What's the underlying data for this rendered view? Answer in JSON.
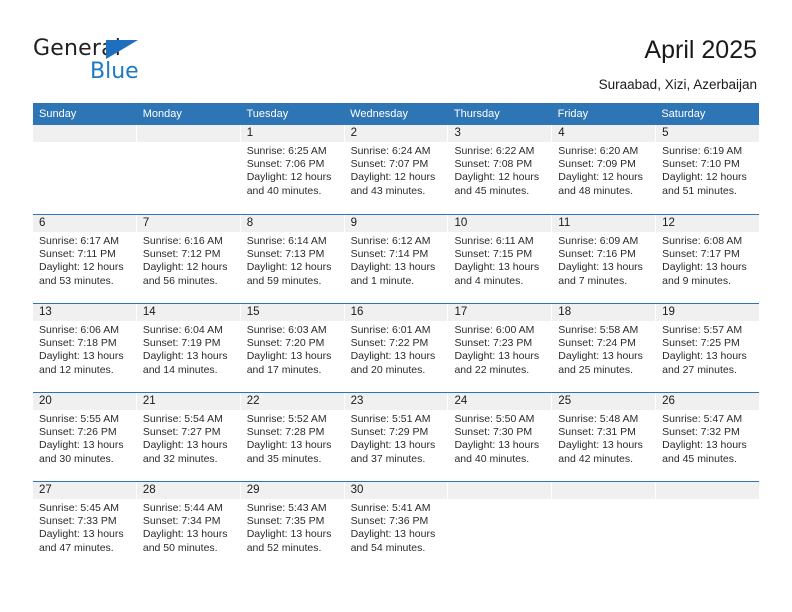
{
  "brand": {
    "name_top": "General",
    "name_bottom": "Blue",
    "accent_color": "#1f7ac4",
    "triangle_color": "#1f6fc0"
  },
  "header": {
    "title": "April 2025",
    "subtitle": "Suraabad, Xizi, Azerbaijan",
    "header_bg": "#2e75b6",
    "daynum_band_bg": "#f0f0f0"
  },
  "weekdays": [
    "Sunday",
    "Monday",
    "Tuesday",
    "Wednesday",
    "Thursday",
    "Friday",
    "Saturday"
  ],
  "weeks": [
    [
      {
        "day": "",
        "lines": []
      },
      {
        "day": "",
        "lines": []
      },
      {
        "day": "1",
        "lines": [
          "Sunrise: 6:25 AM",
          "Sunset: 7:06 PM",
          "Daylight: 12 hours",
          "and 40 minutes."
        ]
      },
      {
        "day": "2",
        "lines": [
          "Sunrise: 6:24 AM",
          "Sunset: 7:07 PM",
          "Daylight: 12 hours",
          "and 43 minutes."
        ]
      },
      {
        "day": "3",
        "lines": [
          "Sunrise: 6:22 AM",
          "Sunset: 7:08 PM",
          "Daylight: 12 hours",
          "and 45 minutes."
        ]
      },
      {
        "day": "4",
        "lines": [
          "Sunrise: 6:20 AM",
          "Sunset: 7:09 PM",
          "Daylight: 12 hours",
          "and 48 minutes."
        ]
      },
      {
        "day": "5",
        "lines": [
          "Sunrise: 6:19 AM",
          "Sunset: 7:10 PM",
          "Daylight: 12 hours",
          "and 51 minutes."
        ]
      }
    ],
    [
      {
        "day": "6",
        "lines": [
          "Sunrise: 6:17 AM",
          "Sunset: 7:11 PM",
          "Daylight: 12 hours",
          "and 53 minutes."
        ]
      },
      {
        "day": "7",
        "lines": [
          "Sunrise: 6:16 AM",
          "Sunset: 7:12 PM",
          "Daylight: 12 hours",
          "and 56 minutes."
        ]
      },
      {
        "day": "8",
        "lines": [
          "Sunrise: 6:14 AM",
          "Sunset: 7:13 PM",
          "Daylight: 12 hours",
          "and 59 minutes."
        ]
      },
      {
        "day": "9",
        "lines": [
          "Sunrise: 6:12 AM",
          "Sunset: 7:14 PM",
          "Daylight: 13 hours",
          "and 1 minute."
        ]
      },
      {
        "day": "10",
        "lines": [
          "Sunrise: 6:11 AM",
          "Sunset: 7:15 PM",
          "Daylight: 13 hours",
          "and 4 minutes."
        ]
      },
      {
        "day": "11",
        "lines": [
          "Sunrise: 6:09 AM",
          "Sunset: 7:16 PM",
          "Daylight: 13 hours",
          "and 7 minutes."
        ]
      },
      {
        "day": "12",
        "lines": [
          "Sunrise: 6:08 AM",
          "Sunset: 7:17 PM",
          "Daylight: 13 hours",
          "and 9 minutes."
        ]
      }
    ],
    [
      {
        "day": "13",
        "lines": [
          "Sunrise: 6:06 AM",
          "Sunset: 7:18 PM",
          "Daylight: 13 hours",
          "and 12 minutes."
        ]
      },
      {
        "day": "14",
        "lines": [
          "Sunrise: 6:04 AM",
          "Sunset: 7:19 PM",
          "Daylight: 13 hours",
          "and 14 minutes."
        ]
      },
      {
        "day": "15",
        "lines": [
          "Sunrise: 6:03 AM",
          "Sunset: 7:20 PM",
          "Daylight: 13 hours",
          "and 17 minutes."
        ]
      },
      {
        "day": "16",
        "lines": [
          "Sunrise: 6:01 AM",
          "Sunset: 7:22 PM",
          "Daylight: 13 hours",
          "and 20 minutes."
        ]
      },
      {
        "day": "17",
        "lines": [
          "Sunrise: 6:00 AM",
          "Sunset: 7:23 PM",
          "Daylight: 13 hours",
          "and 22 minutes."
        ]
      },
      {
        "day": "18",
        "lines": [
          "Sunrise: 5:58 AM",
          "Sunset: 7:24 PM",
          "Daylight: 13 hours",
          "and 25 minutes."
        ]
      },
      {
        "day": "19",
        "lines": [
          "Sunrise: 5:57 AM",
          "Sunset: 7:25 PM",
          "Daylight: 13 hours",
          "and 27 minutes."
        ]
      }
    ],
    [
      {
        "day": "20",
        "lines": [
          "Sunrise: 5:55 AM",
          "Sunset: 7:26 PM",
          "Daylight: 13 hours",
          "and 30 minutes."
        ]
      },
      {
        "day": "21",
        "lines": [
          "Sunrise: 5:54 AM",
          "Sunset: 7:27 PM",
          "Daylight: 13 hours",
          "and 32 minutes."
        ]
      },
      {
        "day": "22",
        "lines": [
          "Sunrise: 5:52 AM",
          "Sunset: 7:28 PM",
          "Daylight: 13 hours",
          "and 35 minutes."
        ]
      },
      {
        "day": "23",
        "lines": [
          "Sunrise: 5:51 AM",
          "Sunset: 7:29 PM",
          "Daylight: 13 hours",
          "and 37 minutes."
        ]
      },
      {
        "day": "24",
        "lines": [
          "Sunrise: 5:50 AM",
          "Sunset: 7:30 PM",
          "Daylight: 13 hours",
          "and 40 minutes."
        ]
      },
      {
        "day": "25",
        "lines": [
          "Sunrise: 5:48 AM",
          "Sunset: 7:31 PM",
          "Daylight: 13 hours",
          "and 42 minutes."
        ]
      },
      {
        "day": "26",
        "lines": [
          "Sunrise: 5:47 AM",
          "Sunset: 7:32 PM",
          "Daylight: 13 hours",
          "and 45 minutes."
        ]
      }
    ],
    [
      {
        "day": "27",
        "lines": [
          "Sunrise: 5:45 AM",
          "Sunset: 7:33 PM",
          "Daylight: 13 hours",
          "and 47 minutes."
        ]
      },
      {
        "day": "28",
        "lines": [
          "Sunrise: 5:44 AM",
          "Sunset: 7:34 PM",
          "Daylight: 13 hours",
          "and 50 minutes."
        ]
      },
      {
        "day": "29",
        "lines": [
          "Sunrise: 5:43 AM",
          "Sunset: 7:35 PM",
          "Daylight: 13 hours",
          "and 52 minutes."
        ]
      },
      {
        "day": "30",
        "lines": [
          "Sunrise: 5:41 AM",
          "Sunset: 7:36 PM",
          "Daylight: 13 hours",
          "and 54 minutes."
        ]
      },
      {
        "day": "",
        "lines": []
      },
      {
        "day": "",
        "lines": []
      },
      {
        "day": "",
        "lines": []
      }
    ]
  ]
}
